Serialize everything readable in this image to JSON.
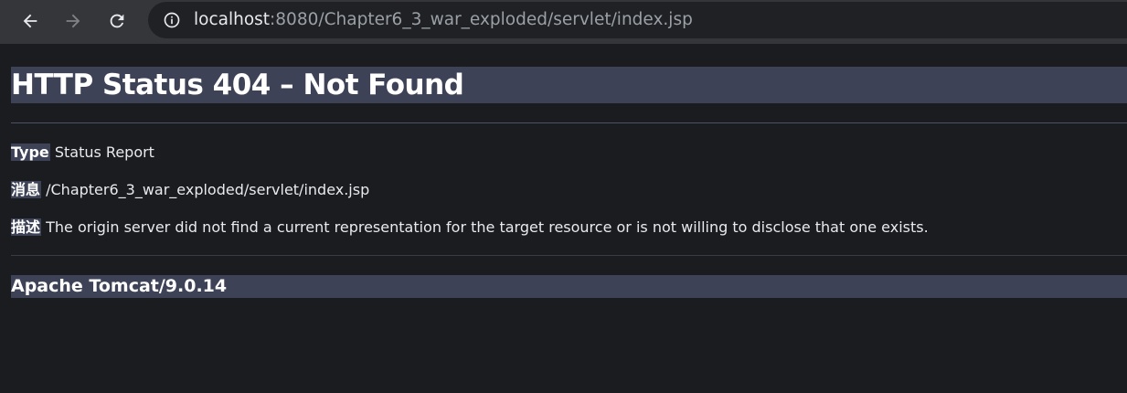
{
  "browser": {
    "url_host": "localhost",
    "url_rest": ":8080/Chapter6_3_war_exploded/servlet/index.jsp",
    "icons": {
      "back": "back-arrow-icon",
      "forward": "forward-arrow-icon",
      "reload": "reload-icon",
      "site_info": "info-icon"
    }
  },
  "page": {
    "title": "HTTP Status 404 – Not Found",
    "type_label": "Type",
    "type_value": "Status Report",
    "message_label": "消息",
    "message_value": "/Chapter6_3_war_exploded/servlet/index.jsp",
    "description_label": "描述",
    "description_value": "The origin server did not find a current representation for the target resource or is not willing to disclose that one exists.",
    "server_info": "Apache Tomcat/9.0.14"
  },
  "colors": {
    "toolbar_bg": "#35363a",
    "omnibox_bg": "#202124",
    "page_bg": "#1b1c1f",
    "header_bar_bg": "#3d4256",
    "text": "#e8eaed"
  }
}
